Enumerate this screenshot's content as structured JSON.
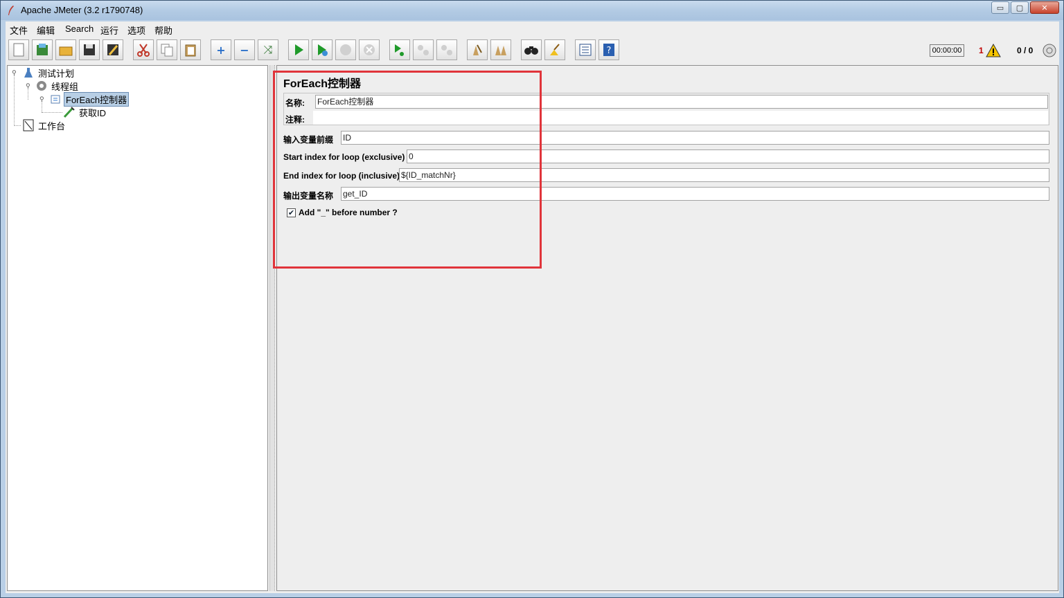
{
  "window": {
    "title": "Apache JMeter (3.2 r1790748)",
    "controls": {
      "minimize": "▭",
      "maximize": "▢",
      "close": "✕"
    }
  },
  "menubar": {
    "items": [
      "文件",
      "编辑",
      "Search",
      "运行",
      "选项",
      "帮助"
    ]
  },
  "toolbar": {
    "buttons": [
      {
        "name": "new-icon"
      },
      {
        "name": "templates-icon"
      },
      {
        "name": "open-icon"
      },
      {
        "name": "save-icon"
      },
      {
        "name": "save-as-icon"
      },
      {
        "name": "cut-icon"
      },
      {
        "name": "copy-icon"
      },
      {
        "name": "paste-icon"
      },
      {
        "name": "expand-icon"
      },
      {
        "name": "collapse-icon"
      },
      {
        "name": "toggle-icon"
      },
      {
        "name": "start-icon"
      },
      {
        "name": "start-no-pauses-icon"
      },
      {
        "name": "stop-icon"
      },
      {
        "name": "shutdown-icon"
      },
      {
        "name": "remote-start-icon"
      },
      {
        "name": "remote-stop-icon"
      },
      {
        "name": "remote-shutdown-icon"
      },
      {
        "name": "clear-icon"
      },
      {
        "name": "clear-all-icon"
      },
      {
        "name": "search-icon"
      },
      {
        "name": "reset-search-icon"
      },
      {
        "name": "function-helper-icon"
      },
      {
        "name": "help-icon"
      }
    ],
    "timer": "00:00:00",
    "error_count": "1",
    "threads": "0 / 0"
  },
  "tree": {
    "nodes": [
      {
        "label": "测试计划",
        "icon": "test-plan-icon"
      },
      {
        "label": "线程组",
        "icon": "thread-group-icon"
      },
      {
        "label": "ForEach控制器",
        "icon": "foreach-controller-icon",
        "selected": true
      },
      {
        "label": "获取ID",
        "icon": "extractor-icon"
      },
      {
        "label": "工作台",
        "icon": "workbench-icon"
      }
    ]
  },
  "panel": {
    "title": "ForEach控制器",
    "name_label": "名称:",
    "name_value": "ForEach控制器",
    "comment_label": "注释:",
    "comment_value": "",
    "input_prefix_label": "输入变量前缀",
    "input_prefix_value": "ID",
    "start_index_label": "Start index for loop (exclusive)",
    "start_index_value": "0",
    "end_index_label": "End index for loop (inclusive)",
    "end_index_value": "${ID_matchNr}",
    "output_var_label": "输出变量名称",
    "output_var_value": "get_ID",
    "add_underscore_label": "Add \"_\" before number ?",
    "add_underscore_checked": true
  },
  "colors": {
    "highlight_box": "#e0343a",
    "selected_node": "#b8cfe5"
  }
}
